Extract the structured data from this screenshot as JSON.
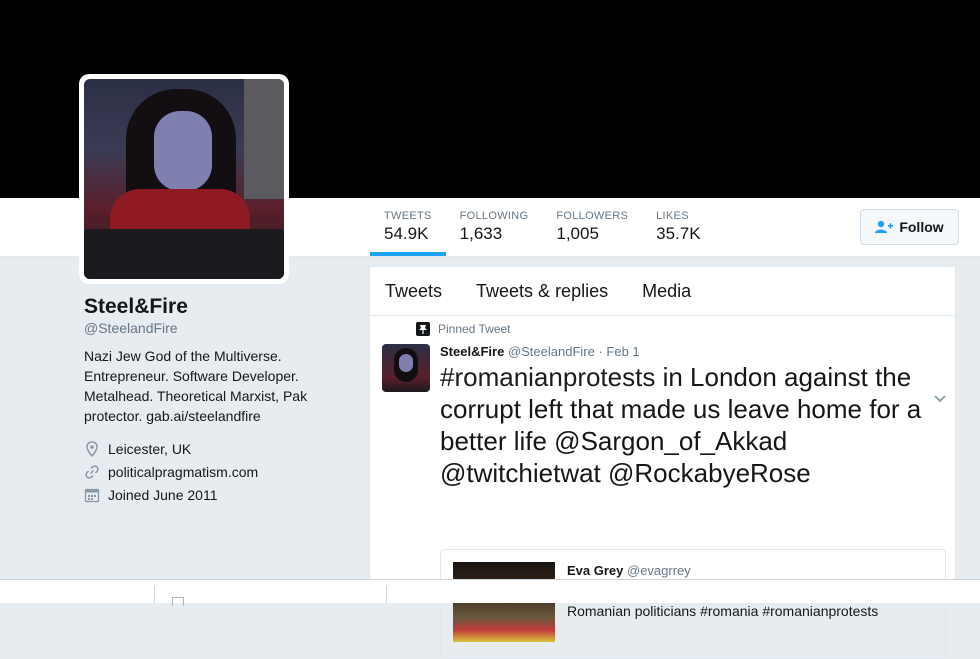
{
  "profile": {
    "name": "Steel&Fire",
    "handle": "@SteelandFire",
    "bio_text": "Nazi Jew God of the Multiverse. Entrepreneur. Software Developer. Metalhead. Theoretical Marxist, Pak protector.",
    "bio_link": "gab.ai/steelandfire",
    "location": "Leicester, UK",
    "website": "politicalpragmatism.com",
    "joined": "Joined June 2011"
  },
  "stats": [
    {
      "label": "TWEETS",
      "value": "54.9K"
    },
    {
      "label": "FOLLOWING",
      "value": "1,633"
    },
    {
      "label": "FOLLOWERS",
      "value": "1,005"
    },
    {
      "label": "LIKES",
      "value": "35.7K"
    }
  ],
  "follow_button": {
    "label": "Follow"
  },
  "tabs": [
    "Tweets",
    "Tweets & replies",
    "Media"
  ],
  "tweet": {
    "pinned_label": "Pinned Tweet",
    "author_name": "Steel&Fire",
    "author_handle": "@SteelandFire",
    "separator": " · ",
    "date": "Feb 1",
    "hashtag": "#romanianprotests",
    "text_after_hashtag": " in London against the corrupt left that made us leave home for a better life ",
    "mention1": "@Sargon_of_Akkad",
    "mention2": "@twitchietwat",
    "mention3": "@RockabyeRose",
    "quoted": {
      "author_name": "Eva Grey",
      "author_handle": "@evagrrey",
      "text": "London protests against the pardon of corrupt senior Romanian politicians #romania #romanianprotests"
    }
  },
  "colors": {
    "accent": "#1da1f2",
    "secondary_text": "#657786",
    "banner": "#000000",
    "background": "#e6ecf0"
  }
}
